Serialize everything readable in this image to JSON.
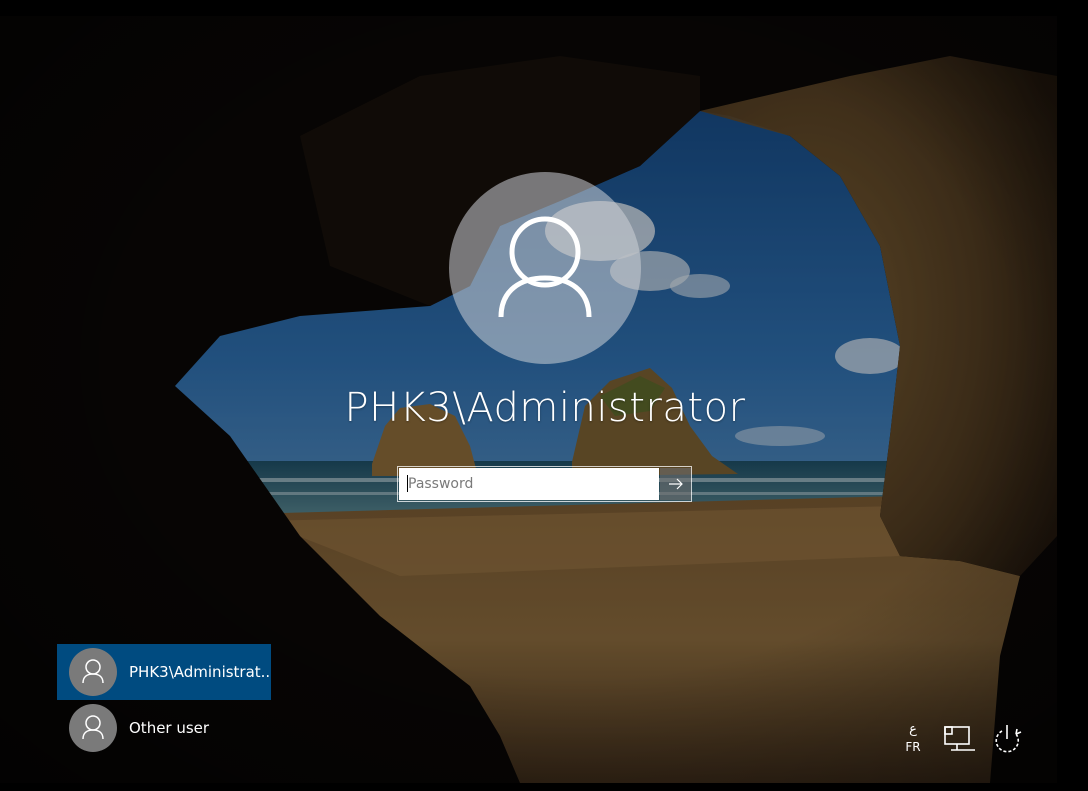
{
  "login": {
    "username": "PHK3\\Administrator",
    "password_placeholder": "Password",
    "password_value": ""
  },
  "user_list": [
    {
      "label": "PHK3\\Administrat...",
      "selected": true
    },
    {
      "label": "Other user",
      "selected": false
    }
  ],
  "tray": {
    "lang_script": "ع",
    "lang_code": "FR",
    "icons": [
      "network-icon",
      "power-icon"
    ]
  },
  "colors": {
    "selected_tile": "#004b80",
    "avatar_circle": "#7a7a7a",
    "text": "#ffffff"
  }
}
